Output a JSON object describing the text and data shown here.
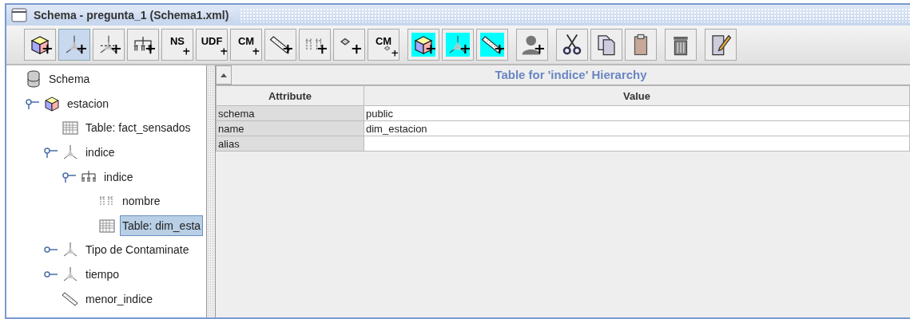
{
  "window": {
    "title": "Schema - pregunta_1 (Schema1.xml)"
  },
  "toolbar": [
    [
      {
        "kind": "cube",
        "highlighted": false,
        "selected": false
      },
      {
        "kind": "dimension",
        "highlighted": false,
        "selected": true
      },
      {
        "kind": "dimension-usage",
        "highlighted": false,
        "selected": false
      },
      {
        "kind": "hierarchy",
        "highlighted": false,
        "selected": false
      },
      {
        "kind": "text",
        "label": "NS",
        "highlighted": false,
        "selected": false
      },
      {
        "kind": "text",
        "label": "UDF",
        "highlighted": false,
        "selected": false
      },
      {
        "kind": "text",
        "label": "CM",
        "highlighted": false,
        "selected": false
      },
      {
        "kind": "measure",
        "highlighted": false,
        "selected": false
      },
      {
        "kind": "level",
        "highlighted": false,
        "selected": false
      },
      {
        "kind": "property",
        "highlighted": false,
        "selected": false
      },
      {
        "kind": "text-property",
        "label": "CM",
        "highlighted": false,
        "selected": false
      }
    ],
    [
      {
        "kind": "cube",
        "highlighted": true,
        "selected": false
      },
      {
        "kind": "dimension",
        "highlighted": true,
        "selected": false
      },
      {
        "kind": "measure",
        "highlighted": true,
        "selected": false
      }
    ],
    [
      {
        "kind": "user",
        "highlighted": false,
        "selected": false
      }
    ],
    [
      {
        "kind": "cut",
        "highlighted": false,
        "selected": false
      },
      {
        "kind": "copy",
        "highlighted": false,
        "selected": false
      },
      {
        "kind": "paste",
        "highlighted": false,
        "selected": false
      }
    ],
    [
      {
        "kind": "delete",
        "highlighted": false,
        "selected": false
      }
    ],
    [
      {
        "kind": "edit",
        "highlighted": false,
        "selected": false
      }
    ]
  ],
  "tree": {
    "label": "Schema",
    "kind": "schema",
    "selected": false,
    "children": [
      {
        "label": "estacion",
        "kind": "cube",
        "expanded": true,
        "selected": false,
        "children": [
          {
            "label": "Table: fact_sensados",
            "kind": "table",
            "selected": false
          },
          {
            "label": "indice",
            "kind": "dimension",
            "expanded": true,
            "selected": false,
            "children": [
              {
                "label": "indice",
                "kind": "hierarchy",
                "expanded": true,
                "selected": false,
                "children": [
                  {
                    "label": "nombre",
                    "kind": "level",
                    "selected": false
                  },
                  {
                    "label": "Table: dim_esta",
                    "kind": "table",
                    "selected": true
                  }
                ]
              }
            ]
          },
          {
            "label": "Tipo de Contaminate",
            "kind": "dimension",
            "expanded": false,
            "selected": false
          },
          {
            "label": "tiempo",
            "kind": "dimension",
            "expanded": false,
            "selected": false
          },
          {
            "label": "menor_indice",
            "kind": "measure",
            "selected": false
          }
        ]
      }
    ]
  },
  "detail": {
    "title": "Table for 'indice' Hierarchy",
    "columns": [
      "Attribute",
      "Value"
    ],
    "rows": [
      {
        "attribute": "schema",
        "value": "public"
      },
      {
        "attribute": "name",
        "value": "dim_estacion"
      },
      {
        "attribute": "alias"
      }
    ]
  }
}
